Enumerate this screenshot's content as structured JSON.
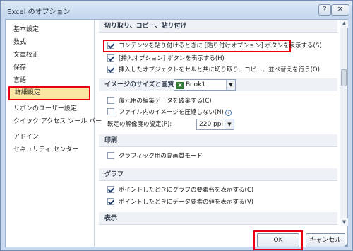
{
  "window": {
    "title": "Excel のオプション",
    "help_label": "?",
    "close_label": "✕"
  },
  "nav": {
    "items": [
      {
        "label": "基本設定"
      },
      {
        "label": "数式"
      },
      {
        "label": "文章校正"
      },
      {
        "label": "保存"
      },
      {
        "label": "言語"
      },
      {
        "label": "詳細設定",
        "selected": true
      },
      {
        "label": "リボンのユーザー設定"
      },
      {
        "label": "クイック アクセス ツール バー"
      },
      {
        "label": "アドイン"
      },
      {
        "label": "セキュリティ センター"
      }
    ]
  },
  "content": {
    "sections": {
      "cut_copy_paste": {
        "title": "切り取り、コピー、貼り付け",
        "options": [
          {
            "label": "コンテンツを貼り付けるときに [貼り付けオプション] ボタンを表示する(S)",
            "checked": true
          },
          {
            "label": "[挿入オプション] ボタンを表示する(H)",
            "checked": true
          },
          {
            "label": "挿入したオブジェクトをセルと共に切り取り、コピー、並べ替えを行う(O)",
            "checked": true
          }
        ]
      },
      "image_size": {
        "title": "イメージのサイズと画質",
        "workbook_value": "Book1",
        "options": [
          {
            "label": "復元用の編集データを破棄する(C)",
            "checked": false
          },
          {
            "label": "ファイル内のイメージを圧縮しない(N)",
            "checked": false
          }
        ],
        "resolution_label": "既定の解像度の設定(P):",
        "resolution_value": "220 ppi"
      },
      "print": {
        "title": "印刷",
        "options": [
          {
            "label": "グラフィック用の高画質モード",
            "checked": false
          }
        ]
      },
      "chart": {
        "title": "グラフ",
        "options": [
          {
            "label": "ポイントしたときにグラフの要素名を表示する(C)",
            "checked": true
          },
          {
            "label": "ポイントしたときにデータ要素の値を表示する(V)",
            "checked": true
          }
        ]
      },
      "display": {
        "title": "表示"
      }
    }
  },
  "footer": {
    "ok_label": "OK",
    "cancel_label": "キャンセル"
  },
  "colors": {
    "highlight": "#e60012",
    "selected_bg": "#fbe7a1",
    "frame": "#c9daf0"
  }
}
